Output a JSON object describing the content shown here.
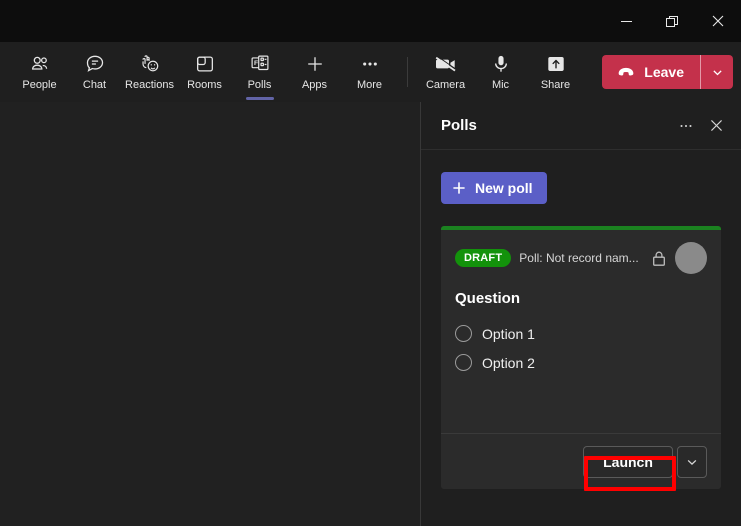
{
  "window": {
    "minimize_label": "Minimize",
    "restore_label": "Restore",
    "close_label": "Close"
  },
  "toolbar": {
    "items": [
      {
        "label": "People",
        "icon": "people-icon",
        "active": false
      },
      {
        "label": "Chat",
        "icon": "chat-icon",
        "active": false
      },
      {
        "label": "Reactions",
        "icon": "reactions-icon",
        "active": false
      },
      {
        "label": "Rooms",
        "icon": "rooms-icon",
        "active": false
      },
      {
        "label": "Polls",
        "icon": "polls-icon",
        "active": true
      },
      {
        "label": "Apps",
        "icon": "apps-plus-icon",
        "active": false
      },
      {
        "label": "More",
        "icon": "more-icon",
        "active": false
      }
    ],
    "media": [
      {
        "label": "Camera",
        "icon": "camera-off-icon"
      },
      {
        "label": "Mic",
        "icon": "microphone-icon"
      },
      {
        "label": "Share",
        "icon": "share-icon"
      }
    ],
    "leave_label": "Leave",
    "leave_caret_icon": "chevron-down-icon",
    "leave_color": "#C4314B",
    "active_underline_color": "#6264A7"
  },
  "panel": {
    "title": "Polls",
    "more_icon": "ellipsis-icon",
    "close_icon": "close-icon",
    "new_poll_label": "New poll",
    "new_poll_icon": "plus-icon",
    "new_poll_color": "#5B5FC7"
  },
  "poll_card": {
    "accent_color": "#1B8220",
    "status_badge": "DRAFT",
    "status_badge_color": "#13920B",
    "meta_text": "Poll: Not record nam...",
    "lock_icon": "lock-closed-icon",
    "avatar_name": "author-avatar",
    "question": "Question",
    "options": [
      {
        "label": "Option 1"
      },
      {
        "label": "Option 2"
      }
    ],
    "launch_label": "Launch",
    "launch_caret_icon": "chevron-down-icon"
  },
  "annotation": {
    "highlight_color": "#FF0000",
    "target": "Launch"
  }
}
